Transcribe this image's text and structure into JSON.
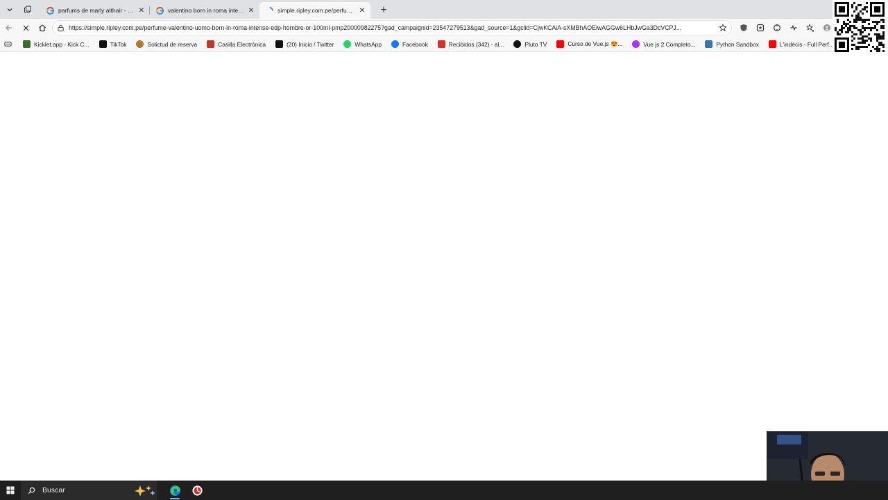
{
  "browser": {
    "tabs": [
      {
        "title": "parfums de marly althair - Buscar c",
        "favicon": "google-icon",
        "active": false
      },
      {
        "title": "valentino born in roma intense - B",
        "favicon": "google-icon",
        "active": false
      },
      {
        "title": "simple.ripley.com.pe/perfume-vale",
        "favicon": "loading-spinner-icon",
        "active": true
      }
    ],
    "new_tab_label": "+",
    "close_glyph": "✕",
    "address": {
      "url": "https://simple.ripley.com.pe/perfume-valentino-uomo-born-in-roma-intense-edp-hombre-or-100ml-pmp20000982275?gad_campaignid=23547279513&gad_source=1&gclid=CjwKCAiA-sXMBhAOEiwAGGw6LHbJwGa3DcVCPJ..."
    },
    "bookmarks": [
      {
        "label": "Kicklet.app - Kick C...",
        "icon": "kicklet-icon",
        "color": "#3a6b2a"
      },
      {
        "label": "TikTok",
        "icon": "tiktok-icon",
        "color": "#111111"
      },
      {
        "label": "Solictud de reserva",
        "icon": "reserva-icon",
        "color": "#b07a2a"
      },
      {
        "label": "Casilla Electrónica",
        "icon": "casilla-icon",
        "color": "#c0392b"
      },
      {
        "label": "(20) Inicio / Twitter",
        "icon": "x-twitter-icon",
        "color": "#111111"
      },
      {
        "label": "WhatsApp",
        "icon": "whatsapp-icon",
        "color": "#25d366"
      },
      {
        "label": "Facebook",
        "icon": "facebook-icon",
        "color": "#1877f2"
      },
      {
        "label": "Recibidos (342) - al...",
        "icon": "gmail-icon",
        "color": "#d93025"
      },
      {
        "label": "Pluto TV",
        "icon": "pluto-tv-icon",
        "color": "#111111"
      },
      {
        "label": "Curso de Vue.js 😍...",
        "icon": "youtube-icon",
        "color": "#ff0000"
      },
      {
        "label": "Vue js 2 Completo...",
        "icon": "udemy-icon",
        "color": "#a435f0"
      },
      {
        "label": "Python Sandbox",
        "icon": "python-icon",
        "color": "#3776ab"
      },
      {
        "label": "L'indécis - Full Perf...",
        "icon": "youtube-icon",
        "color": "#ff0000"
      }
    ]
  },
  "taskbar": {
    "search_label": "Buscar"
  },
  "colors": {
    "tabstrip": "#dfe1e5",
    "toolbar": "#f7f7f7",
    "taskbar": "#1f1f1f",
    "accent": "#7eb7ff"
  }
}
